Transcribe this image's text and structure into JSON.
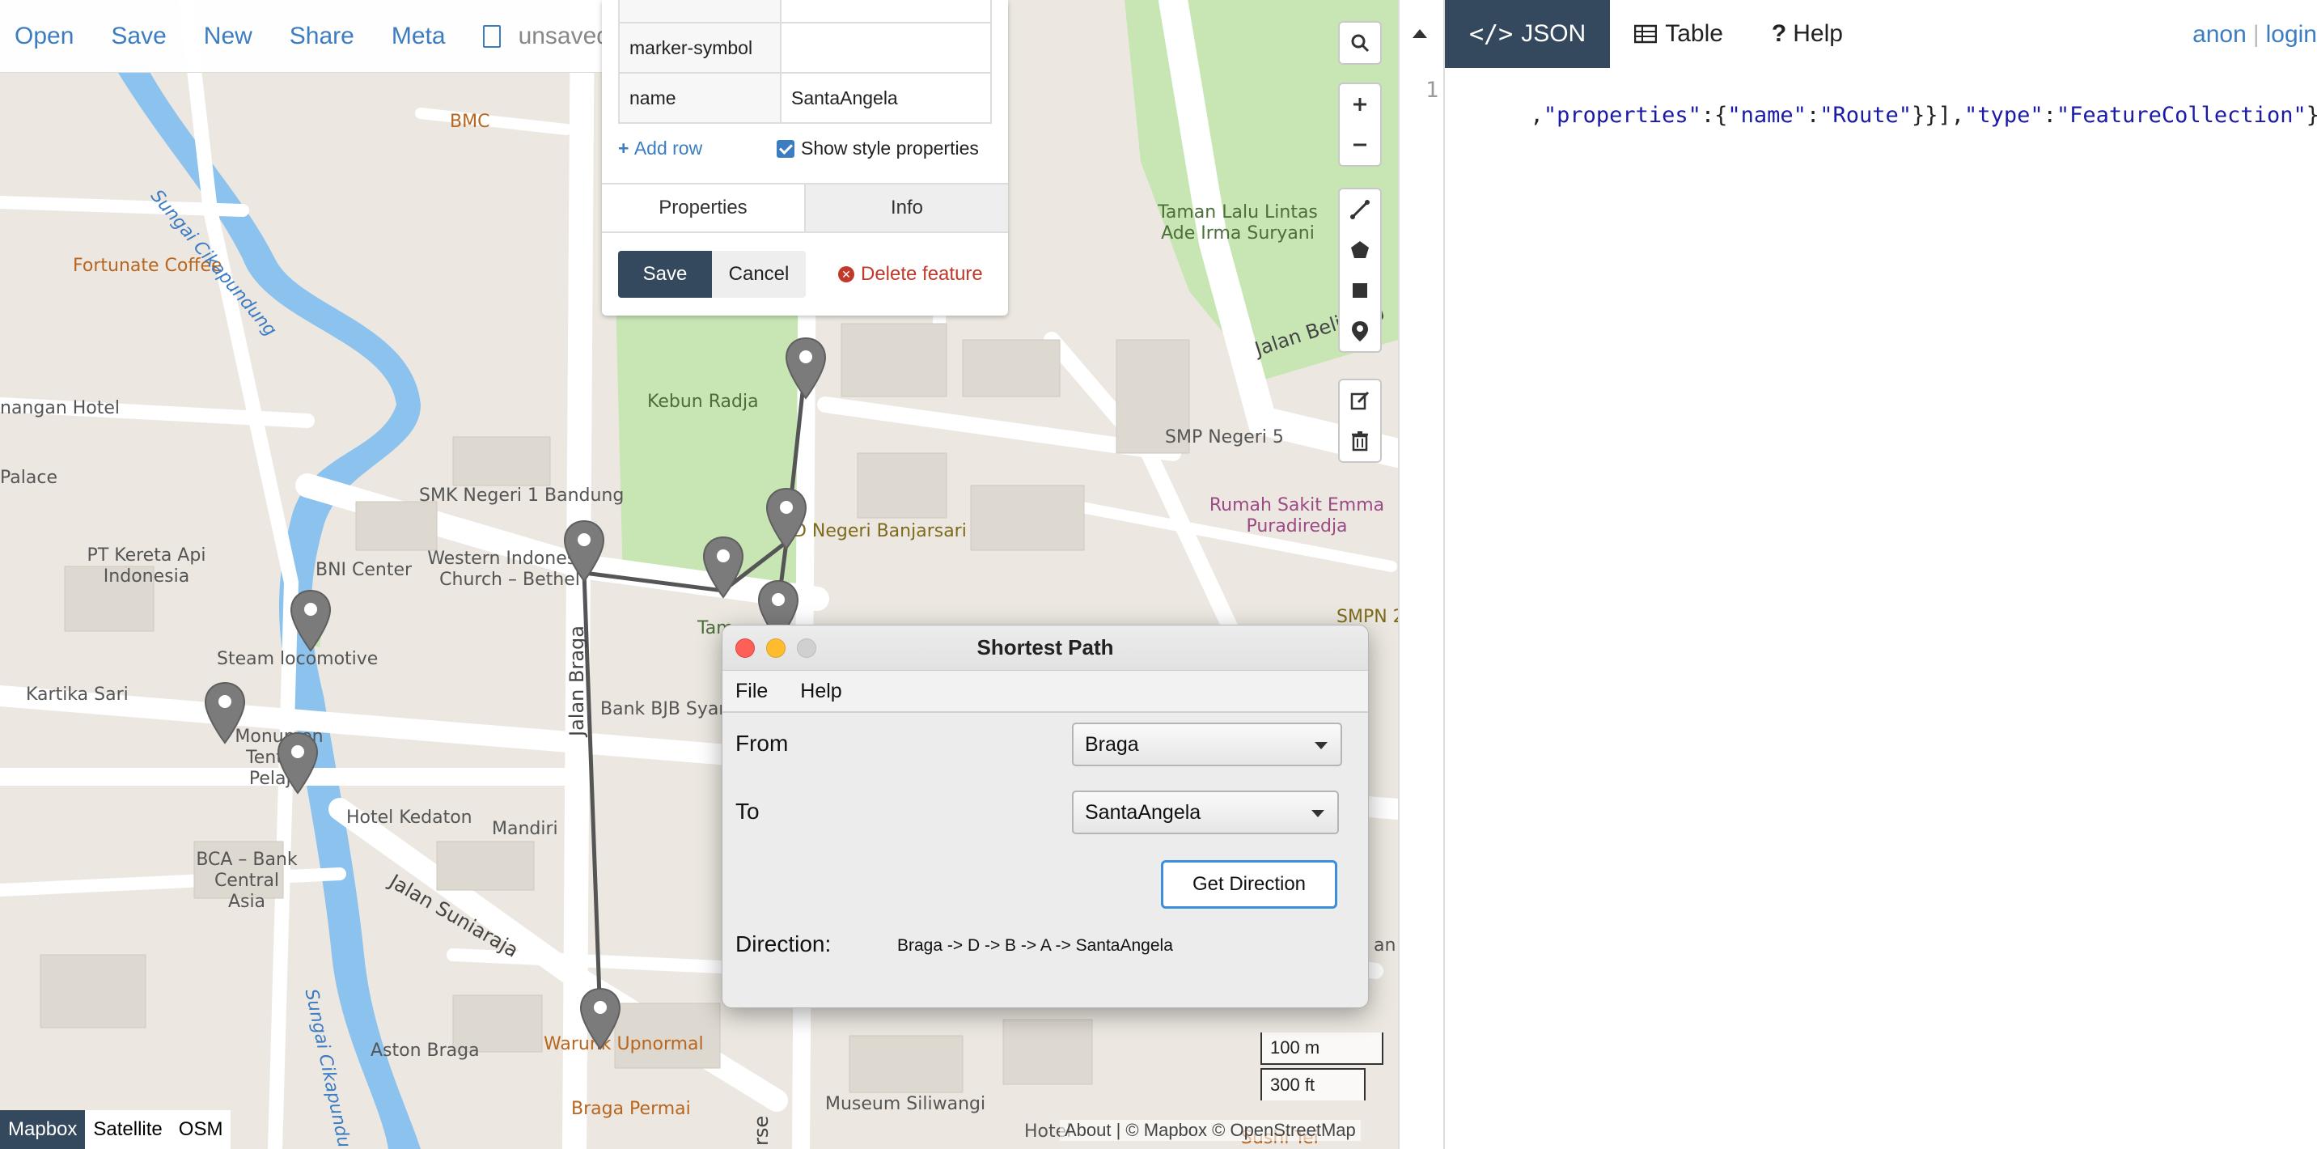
{
  "toolbar": {
    "open": "Open",
    "save": "Save",
    "new": "New",
    "share": "Share",
    "meta": "Meta",
    "file_status": "unsaved"
  },
  "popup": {
    "rows": [
      {
        "key": "marker-symbol",
        "value": ""
      },
      {
        "key": "name",
        "value": "SantaAngela"
      }
    ],
    "add_row": "Add row",
    "show_style": "Show style properties",
    "tabs": [
      "Properties",
      "Info"
    ],
    "save": "Save",
    "cancel": "Cancel",
    "delete": "Delete feature"
  },
  "map_labels": {
    "bmc": "BMC",
    "fortunate": "Fortunate Coffee",
    "sungai1": "Sungai Cikapundung",
    "nangan": "nangan Hotel",
    "palace": "Palace",
    "pt_kereta": "PT Kereta Api Indonesia",
    "bni": "BNI Center",
    "smk": "SMK Negeri 1 Bandung",
    "church": "Western Indonesia Church – Bethel",
    "kebun": "Kebun Radja",
    "taman": "Taman Lalu Lintas Ade Irma Suryani",
    "smp5": "SMP Negeri 5",
    "jalan_belitung": "Jalan Belitung",
    "rs_emma": "Rumah Sakit Emma Puradiredja",
    "sd": "D Negeri Banjarsari",
    "smpn": "SMPN 2",
    "steam": "Steam locomotive",
    "kartika": "Kartika Sari",
    "monumen": "Monumen Tentara Pelajar",
    "tam": "Tam",
    "bank_bjb": "Bank BJB Syar",
    "jalan_braga": "Jalan Braga",
    "hotel_kedaton": "Hotel Kedaton",
    "mandiri": "Mandiri",
    "bca": "BCA – Bank Central Asia",
    "suniaraja": "Jalan Suniaraja",
    "sungai2": "Sungai Cikapundung",
    "aston": "Aston Braga",
    "warunk": "Warunk Upnormal",
    "braga_permai": "Braga Permai",
    "museum": "Museum Siliwangi",
    "hotel_bottom": "Hotel",
    "sushi": "Sushi Tei",
    "jalan_partial": "rse",
    "an_partial": "an"
  },
  "layers": [
    "Mapbox",
    "Satellite",
    "OSM"
  ],
  "scale": {
    "metric": "100 m",
    "imperial": "300 ft"
  },
  "attribution": "About | © Mapbox © OpenStreetMap",
  "right_pane": {
    "tabs": [
      {
        "label": "JSON",
        "icon": "code-icon"
      },
      {
        "label": "Table",
        "icon": "table-icon"
      },
      {
        "label": "Help",
        "icon": "help-icon"
      }
    ],
    "user": "anon",
    "login": "login",
    "line_number": "1",
    "code_prefix": ",",
    "code_k1": "\"properties\"",
    "code_mid1": ":{",
    "code_k2": "\"name\"",
    "code_mid2": ":",
    "code_v2": "\"Route\"",
    "code_mid3": "}}],",
    "code_k3": "\"type\"",
    "code_mid4": ":",
    "code_v3": "\"FeatureCollection\"",
    "code_end": "}"
  },
  "dialog": {
    "title": "Shortest Path",
    "menu": [
      "File",
      "Help"
    ],
    "from_label": "From",
    "from_value": "Braga",
    "to_label": "To",
    "to_value": "SantaAngela",
    "button": "Get Direction",
    "direction_label": "Direction:",
    "direction_value": "Braga -> D -> B -> A -> SantaAngela"
  },
  "colors": {
    "accent": "#3c7dc1",
    "dark": "#34495e",
    "map_bg": "#ece8e1",
    "park": "#c8e6b4",
    "water": "#8cc3ee",
    "delete": "#c0392b"
  }
}
